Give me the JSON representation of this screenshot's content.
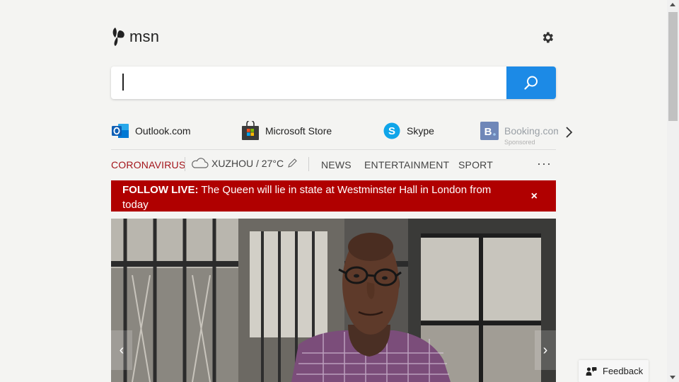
{
  "logo": {
    "text": "msn",
    "icon": "msn-butterfly-icon"
  },
  "settings": {
    "icon": "gear-icon"
  },
  "search": {
    "value": "",
    "placeholder": "",
    "button_icon": "search-icon"
  },
  "quick_links": [
    {
      "label": "Outlook.com",
      "icon": "outlook-icon"
    },
    {
      "label": "Microsoft Store",
      "icon": "microsoft-store-icon"
    },
    {
      "label": "Skype",
      "icon": "skype-icon"
    },
    {
      "label": "Booking.com",
      "icon": "booking-icon",
      "note": "Sponsored"
    }
  ],
  "nav": {
    "coronavirus": "CORONAVIRUS",
    "weather": "XUZHOU / 27°C",
    "items": [
      "NEWS",
      "ENTERTAINMENT",
      "SPORT"
    ],
    "more": "···"
  },
  "banner": {
    "prefix": "FOLLOW LIVE:",
    "text": " The Queen will lie in state at Westminster Hall in London from today",
    "close": "×"
  },
  "carousel": {
    "prev": "‹",
    "next": "›"
  },
  "feedback": {
    "label": "Feedback"
  },
  "colors": {
    "accent": "#1c8ae6",
    "banner": "#b00000",
    "corona": "#a3141a",
    "background": "#f4f4f2"
  }
}
